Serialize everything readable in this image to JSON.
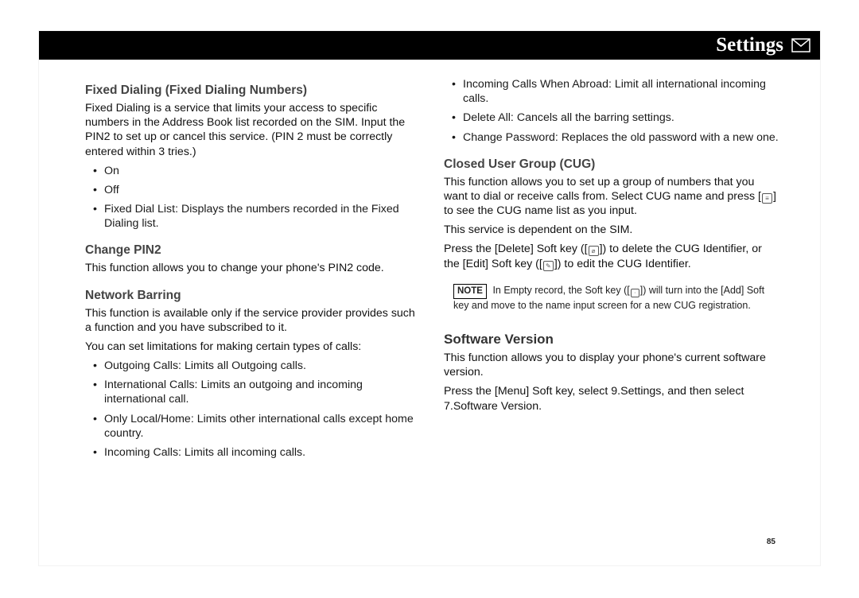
{
  "header": {
    "title": "Settings"
  },
  "left": {
    "h_fixed_dialing": "Fixed Dialing (Fixed Dialing Numbers)",
    "p_fixed_dialing": "Fixed Dialing is a service that limits your access to specific numbers in the Address Book list recorded on the SIM. Input the PIN2 to set up or cancel this service. (PIN 2 must be correctly entered within 3 tries.)",
    "li_on": "On",
    "li_off": "Off",
    "li_fdl": "Fixed Dial List: Displays the numbers recorded in the Fixed Dialing list.",
    "h_change_pin2": "Change PIN2",
    "p_change_pin2": "This function allows you to change your phone's PIN2 code.",
    "h_network_barring": "Network Barring",
    "p_nb1": "This function is available only if the service provider provides such a function and you have subscribed to it.",
    "p_nb2": "You can set limitations for making certain types of calls:",
    "li_nb_out": "Outgoing Calls: Limits all Outgoing calls.",
    "li_nb_intl": "International Calls: Limits an outgoing and incoming international call.",
    "li_nb_local": "Only Local/Home: Limits other international calls except home country.",
    "li_nb_in": "Incoming Calls: Limits all incoming calls."
  },
  "right": {
    "li_nb_abroad": "Incoming Calls When Abroad: Limit all international incoming calls.",
    "li_nb_delete": "Delete All: Cancels all the barring settings.",
    "li_nb_change_pw": "Change Password: Replaces the old password with a new one.",
    "h_cug": "Closed User Group (CUG)",
    "p_cug1_a": "This function allows you to set up a group of numbers that you want to dial or receive calls from. Select CUG name and press [",
    "p_cug1_b": "] to see the CUG name list as you input.",
    "p_cug2": "This service is dependent on the SIM.",
    "p_cug3_a": "Press the [Delete] Soft key ([",
    "p_cug3_b": "]) to delete the CUG Identifier, or the [Edit] Soft key ([",
    "p_cug3_c": "]) to edit the CUG Identifier.",
    "note_label": "NOTE",
    "note_a": "In Empty record, the Soft key ([",
    "note_b": "]) will turn into the [Add] Soft key and move to the name input screen for a new CUG registration.",
    "h_sw": "Software Version",
    "p_sw1": "This function allows you to display your phone's current software version.",
    "p_sw2": "Press the [Menu] Soft key, select 9.Settings, and then select 7.Software Version."
  },
  "page_number": "85"
}
